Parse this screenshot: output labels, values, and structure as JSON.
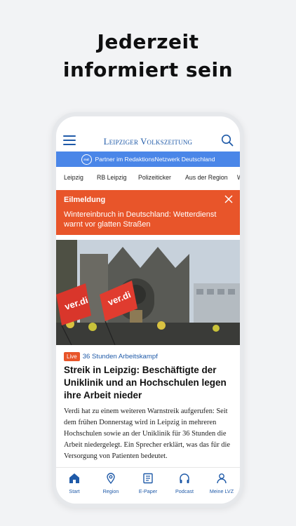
{
  "promo": {
    "line1": "Jederzeit",
    "line2": "informiert sein"
  },
  "app": {
    "brand": "Leipziger Volkszeitung",
    "partner_badge": "rnd",
    "partner_text": "Partner im RedaktionsNetzwerk Deutschland"
  },
  "nav": {
    "items": [
      "Leipzig",
      "RB Leipzig",
      "Polizeiticker",
      "Aus der Region",
      "W"
    ]
  },
  "breaking": {
    "label": "Eilmeldung",
    "text": "Wintereinbruch in Deutschland: Wetterdienst warnt vor glatten Straßen"
  },
  "article": {
    "live_badge": "Live",
    "tag": "36 Stunden Arbeitskampf",
    "title": "Streik in Leipzig: Beschäftigte der Uniklinik und an Hochschulen legen ihre Arbeit nieder",
    "body": "Verdi hat zu einem weiteren Warnstreik aufgerufen: Seit dem frühen Donnerstag wird in Leipzig in mehreren Hochschulen sowie an der Uniklinik für 36 Stunden die Arbeit niedergelegt. Ein Sprecher erklärt, was das für die Versorgung von Patienten bedeutet.",
    "flag_text_1": "ver.di",
    "flag_text_2": "ver.di"
  },
  "tabs": [
    {
      "label": "Start",
      "icon": "home-icon",
      "active": true
    },
    {
      "label": "Region",
      "icon": "location-pin-icon"
    },
    {
      "label": "E-Paper",
      "icon": "epaper-icon"
    },
    {
      "label": "Podcast",
      "icon": "headphones-icon"
    },
    {
      "label": "Meine LVZ",
      "icon": "user-icon"
    }
  ],
  "colors": {
    "brand_blue": "#1f5aa8",
    "partner_blue": "#4a86e8",
    "breaking_orange": "#e8552a"
  }
}
